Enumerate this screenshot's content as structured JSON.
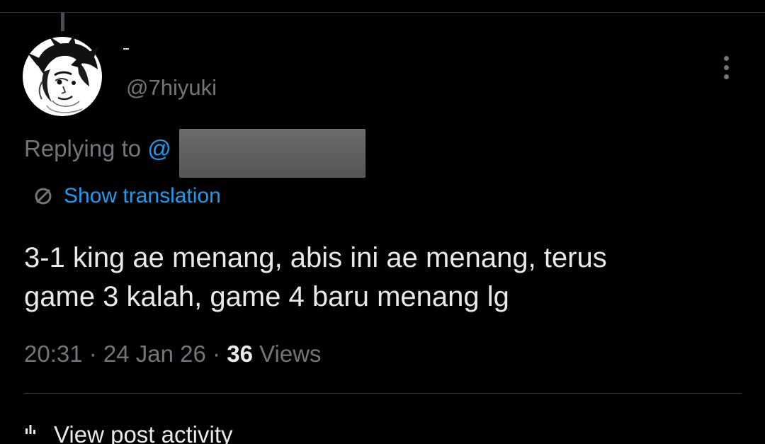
{
  "post": {
    "handle": "@7hiyuki",
    "display_name": "-",
    "replying_prefix": "Replying to ",
    "replying_mention": "@",
    "show_translation_label": "Show translation",
    "text": "3-1 king ae menang, abis ini ae menang, terus\ngame 3 kalah, game 4 baru menang lg",
    "time": "20:31",
    "date": "24 Jan 26",
    "separator": " · ",
    "views_count": "36",
    "views_label": "Views",
    "activity_label": "View post activity"
  },
  "icons": {
    "more": "more-vertical-icon",
    "translate": "globe-translate-icon",
    "activity": "bar-chart-icon"
  },
  "colors": {
    "background": "#000000",
    "primary_text": "#e7e9ea",
    "secondary_text": "#71767b",
    "link": "#1d9bf0",
    "divider": "#2f3336",
    "redaction": "#5f5f5f"
  }
}
